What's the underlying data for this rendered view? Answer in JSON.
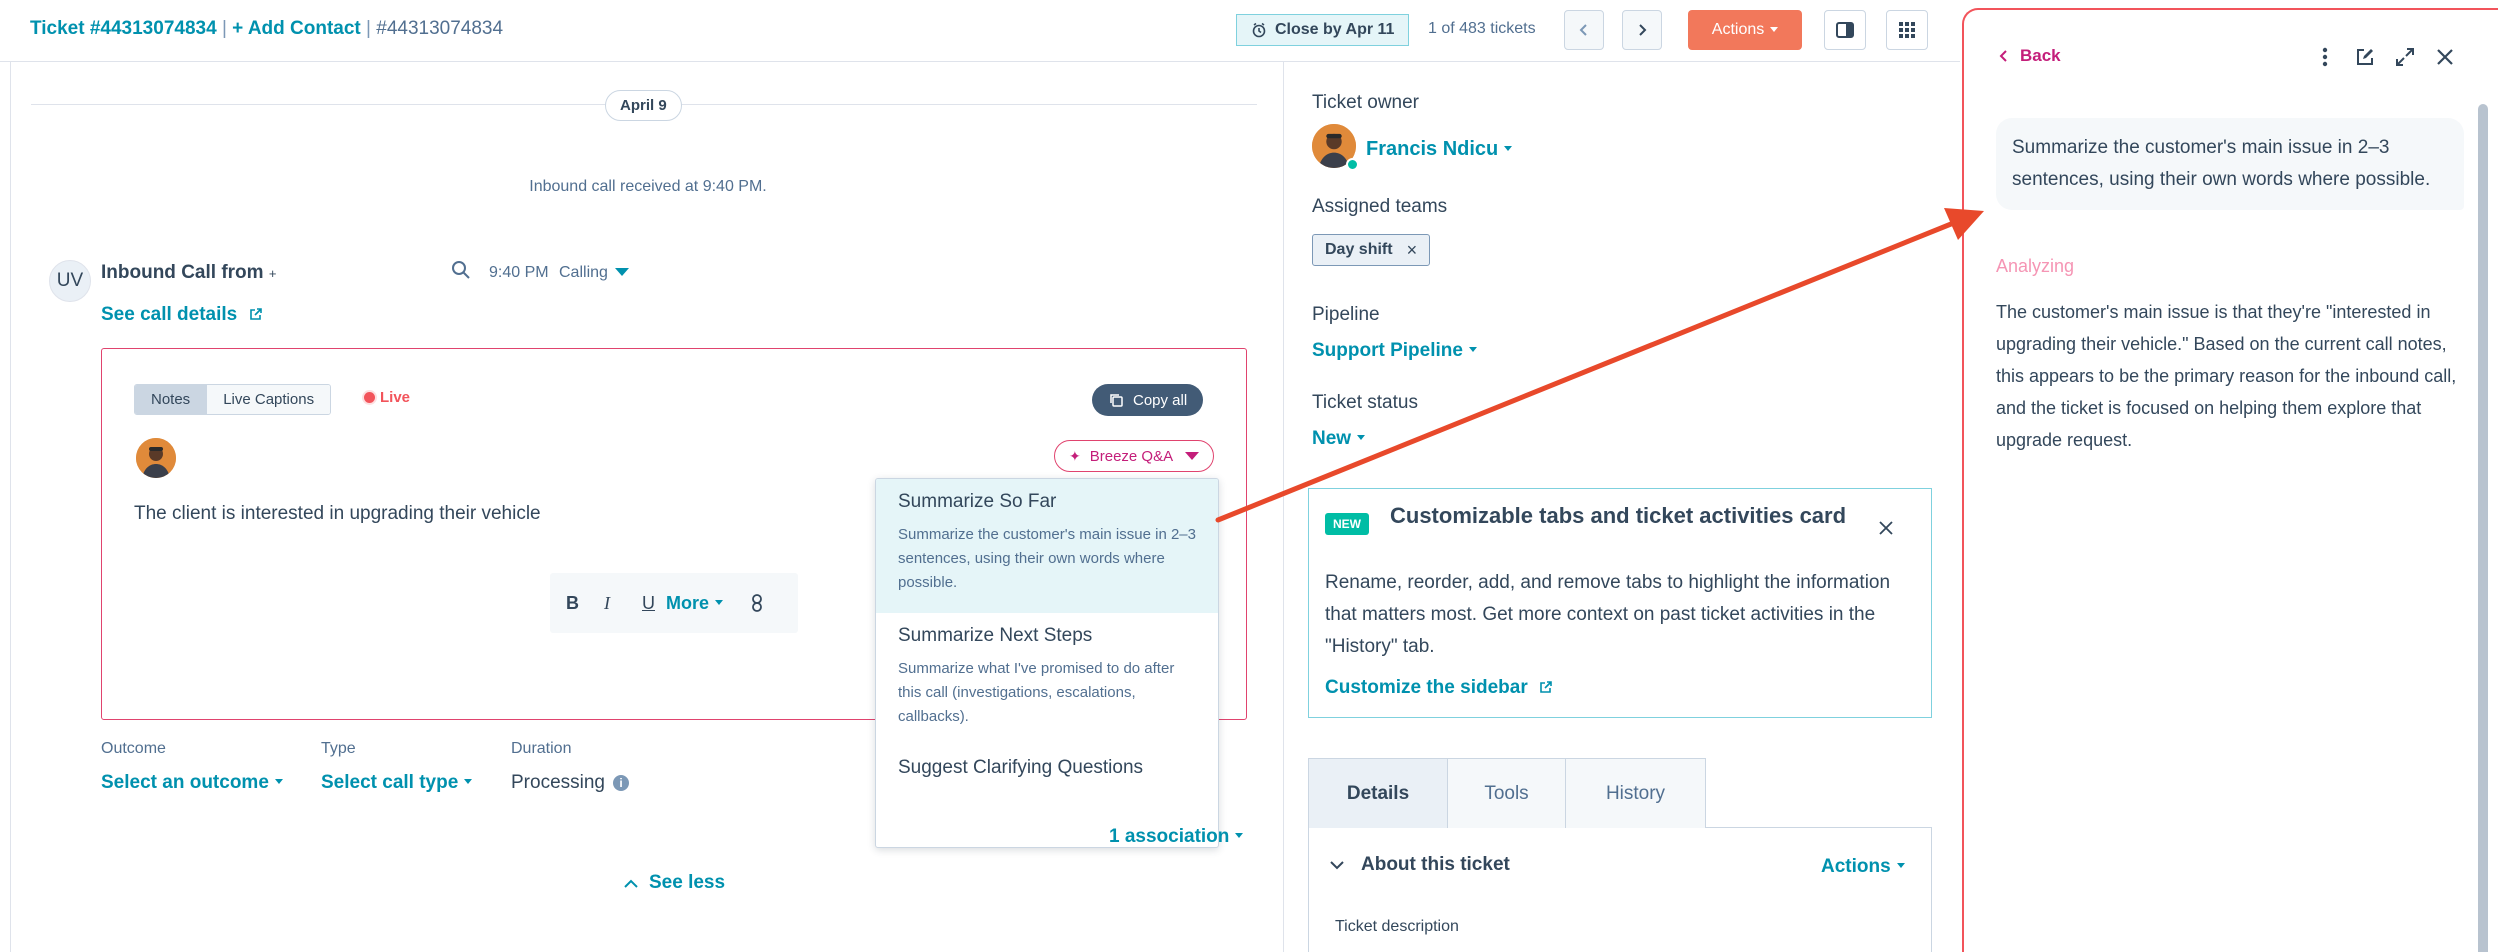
{
  "header": {
    "ticket_title": "Ticket #44313074834",
    "sep1": "|",
    "add_contact": "+ Add Contact",
    "sep2": "|",
    "ticket_id": "#44313074834",
    "close_by": "Close by Apr 11",
    "pagination": "1 of 483 tickets",
    "actions_label": "Actions"
  },
  "timeline": {
    "date_pill": "April 9",
    "inbound_received": "Inbound call received at 9:40 PM."
  },
  "call": {
    "avatar_initials": "UV",
    "title": "Inbound Call from",
    "title_suffix": "+",
    "time": "9:40 PM",
    "status": "Calling",
    "see_call_details": "See call details"
  },
  "notes": {
    "tab_notes": "Notes",
    "tab_live_captions": "Live Captions",
    "live_label": "Live",
    "copy_all": "Copy all",
    "breeze_qa": "Breeze Q&A",
    "note_text": "The client is interested in upgrading their vehicle",
    "toolbar": {
      "bold": "B",
      "italic": "I",
      "underline": "U",
      "more": "More"
    }
  },
  "breeze_menu": {
    "items": [
      {
        "title": "Summarize So Far",
        "desc": "Summarize the customer's main issue in 2–3 sentences, using their own words where possible."
      },
      {
        "title": "Summarize Next Steps",
        "desc": "Summarize what I've promised to do after this call (investigations, escalations, callbacks)."
      },
      {
        "title": "Suggest Clarifying Questions",
        "desc": ""
      }
    ]
  },
  "call_fields": {
    "outcome_label": "Outcome",
    "outcome_value": "Select an outcome",
    "type_label": "Type",
    "type_value": "Select call type",
    "duration_label": "Duration",
    "duration_value": "Processing",
    "association": "1 association",
    "see_less": "See less"
  },
  "sidebar": {
    "owner_label": "Ticket owner",
    "owner_name": "Francis Ndicu",
    "teams_label": "Assigned teams",
    "team_tag": "Day shift",
    "pipeline_label": "Pipeline",
    "pipeline_value": "Support Pipeline",
    "status_label": "Ticket status",
    "status_value": "New",
    "card": {
      "badge": "NEW",
      "title": "Customizable tabs and ticket activities card",
      "body": "Rename, reorder, add, and remove tabs to highlight the information that matters most. Get more context on past ticket activities in the \"History\" tab.",
      "link": "Customize the sidebar"
    },
    "tabs": [
      "Details",
      "Tools",
      "History"
    ],
    "about_title": "About this ticket",
    "about_actions": "Actions",
    "ticket_description_label": "Ticket description"
  },
  "copilot": {
    "back": "Back",
    "prompt": "Summarize the customer's main issue in 2–3 sentences, using their own words where possible.",
    "analyzing": "Analyzing",
    "response": "The customer's main issue is that they're \"interested in upgrading their vehicle.\" Based on the current call notes, this appears to be the primary reason for the inbound call, and the ticket is focused on helping them explore that upgrade request."
  },
  "colors": {
    "accent_teal": "#0091ae",
    "actions_orange": "#f2785b",
    "live_red": "#f2545b",
    "breeze_pink": "#c41e7a",
    "arrow_red": "#e8492b"
  }
}
